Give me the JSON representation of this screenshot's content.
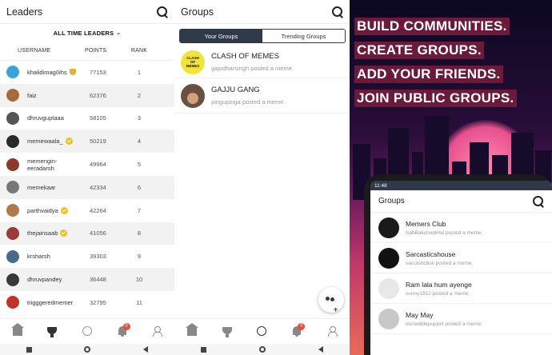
{
  "leaders": {
    "title": "Leaders",
    "filter": "ALL TIME LEADERS",
    "filter_caret": "⌄",
    "columns": {
      "username": "USERNAME",
      "points": "POINTS",
      "rank": "RANK"
    },
    "rows": [
      {
        "name": "khalidimag0ihs",
        "points": "77153",
        "rank": "1",
        "avatar": "#3ba3d8",
        "mark": "trophy"
      },
      {
        "name": "faiz",
        "points": "62376",
        "rank": "2",
        "avatar": "#a86a3a",
        "mark": ""
      },
      {
        "name": "dhruvguptaaa",
        "points": "58105",
        "rank": "3",
        "avatar": "#555555",
        "mark": ""
      },
      {
        "name": "memewaala_",
        "points": "50219",
        "rank": "4",
        "avatar": "#2a2a2a",
        "mark": "verified"
      },
      {
        "name": "memengin-eeradarsh",
        "points": "49964",
        "rank": "5",
        "avatar": "#8a3a2a",
        "mark": ""
      },
      {
        "name": "memekaar",
        "points": "42334",
        "rank": "6",
        "avatar": "#777777",
        "mark": ""
      },
      {
        "name": "parthvaidya",
        "points": "42264",
        "rank": "7",
        "avatar": "#b07a4a",
        "mark": "verified"
      },
      {
        "name": "thejainsaab",
        "points": "41056",
        "rank": "8",
        "avatar": "#9a3a3a",
        "mark": "verified"
      },
      {
        "name": "krsharsh",
        "points": "39303",
        "rank": "9",
        "avatar": "#4a6a8a",
        "mark": ""
      },
      {
        "name": "dhruvpandey",
        "points": "36448",
        "rank": "10",
        "avatar": "#3a3a3a",
        "mark": ""
      },
      {
        "name": "trigggeredmemer",
        "points": "32795",
        "rank": "11",
        "avatar": "#c0342a",
        "mark": ""
      }
    ]
  },
  "groups": {
    "title": "Groups",
    "tabs": {
      "active": "Your Groups",
      "inactive": "Trending Groups"
    },
    "items": [
      {
        "name": "CLASH OF MEMES",
        "subtitle": "gajodharsingh posted a meme.",
        "avatar_text": "CLASH OF MEMES",
        "avatar": "#f0e43a"
      },
      {
        "name": "GAJJU GANG",
        "subtitle": "pingupinga posted a meme.",
        "avatar_text": "",
        "avatar": "#6a5040"
      }
    ]
  },
  "nav": {
    "notification_count": "0"
  },
  "promo": {
    "lines": [
      "BUILD COMMUNITIES.",
      "CREATE GROUPS.",
      "ADD YOUR FRIENDS.",
      "JOIN PUBLIC GROUPS."
    ],
    "phone": {
      "time": "11:48",
      "title": "Groups",
      "items": [
        {
          "name": "Memers Club",
          "subtitle": "SabBakchodiHai posted a meme.",
          "avatar": "#1a1a1a"
        },
        {
          "name": "Sarcasticshouse",
          "subtitle": "sarcasticboii posted a meme.",
          "avatar": "#111111"
        },
        {
          "name": "Ram lala hum ayenge",
          "subtitle": "sunny1812 posted a meme.",
          "avatar": "#e8e8e8"
        },
        {
          "name": "May May",
          "subtitle": "incrediblepuppet posted a meme.",
          "avatar": "#c8c8c8"
        }
      ]
    }
  }
}
